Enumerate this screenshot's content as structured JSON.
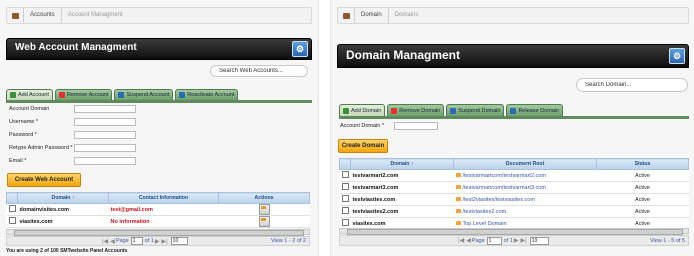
{
  "left": {
    "breadcrumb": [
      "Accounts",
      "Account Managment"
    ],
    "title": "Web Account Managment",
    "search_placeholder": "Search Web Accounts...",
    "tabs": [
      "Add Account",
      "Remove Account",
      "Suspend Account",
      "Reactivate Account"
    ],
    "form": {
      "fields": [
        "Account Domain",
        "Username *",
        "Password *",
        "Retype Admin Password *",
        "Email *"
      ]
    },
    "create_button": "Create Web Account",
    "table": {
      "headers": [
        "Domain",
        "Contact Information",
        "Actions"
      ],
      "rows": [
        {
          "domain": "domainvisites.com",
          "contact": "test@gmail.com"
        },
        {
          "domain": "viasites.com",
          "contact": "No information"
        }
      ]
    },
    "pager": {
      "page_label": "Page",
      "page_value": "1",
      "of_label": "of 1",
      "per_page": "10",
      "summary": "View 1 - 2 of 2"
    },
    "footnote": "You are using 2 of 100 SMTwebsite Panel Accounts"
  },
  "right": {
    "breadcrumb": [
      "Domain",
      "Domains"
    ],
    "title": "Domain Managment",
    "search_placeholder": "Search Domain...",
    "tabs": [
      "Add Domain",
      "Remove Domain",
      "Suspend Domain",
      "Release Domain"
    ],
    "form": {
      "fields": [
        "Account Domain *"
      ]
    },
    "create_button": "Create Domain",
    "table": {
      "headers": [
        "Domain",
        "Document Root",
        "Status"
      ],
      "rows": [
        {
          "domain": "testvarmart2.com",
          "root": "/testvarmartcom/testvarmart2.com",
          "status": "Active"
        },
        {
          "domain": "testvarmart3.com",
          "root": "/testvarmartcom/testvarmart3.com",
          "status": "Active"
        },
        {
          "domain": "testviasites.com",
          "root": "/test2viasites/testviasites.com",
          "status": "Active"
        },
        {
          "domain": "testviasites2.com",
          "root": "/testviasites2.com",
          "status": "Active"
        },
        {
          "domain": "viasites.com",
          "root": "Top Level Domain",
          "status": "Active"
        }
      ]
    },
    "pager": {
      "page_label": "Page",
      "page_value": "1",
      "of_label": "of 1",
      "per_page": "10",
      "summary": "View 1 - 5 of 5"
    }
  },
  "colors": {
    "tab_green": "#6f9f6d",
    "button_orange": "#f2a60c",
    "error_red": "#c0151d",
    "link_blue": "#3a57a6"
  }
}
